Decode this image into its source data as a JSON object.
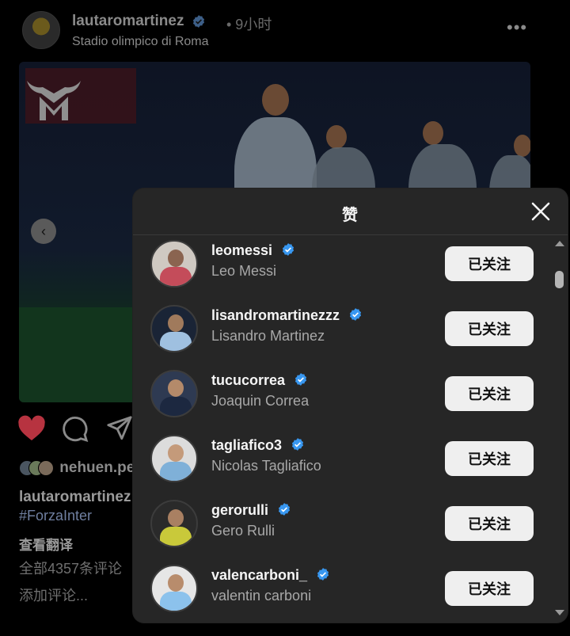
{
  "post": {
    "username": "lautaromartinez",
    "time": "• 9小时",
    "location": "Stadio olimpico di Roma",
    "more": "•••",
    "liked_by_partial": "nehuen.pe",
    "caption_user_partial": "lautaromartinez",
    "caption_tag_partial": "#ForzaInter",
    "translate_label": "查看翻译",
    "comments_partial": "全部4357条评论",
    "add_comment_partial": "添加评论..."
  },
  "modal": {
    "title": "赞",
    "close_icon": "close-icon",
    "follow_label": "已关注",
    "users": [
      {
        "username": "leomessi",
        "full_name": "Leo Messi"
      },
      {
        "username": "lisandromartinezzz",
        "full_name": "Lisandro Martinez"
      },
      {
        "username": "tucucorrea",
        "full_name": "Joaquin Correa"
      },
      {
        "username": "tagliafico3",
        "full_name": "Nicolas Tagliafico"
      },
      {
        "username": "gerorulli",
        "full_name": "Gero Rulli"
      },
      {
        "username": "valencarboni_",
        "full_name": "valentin carboni"
      }
    ]
  },
  "colors": {
    "background": "#000000",
    "modal": "#262626",
    "follow_button": "#efefef",
    "verified": "#3897f0",
    "like_heart": "#ed4956"
  }
}
